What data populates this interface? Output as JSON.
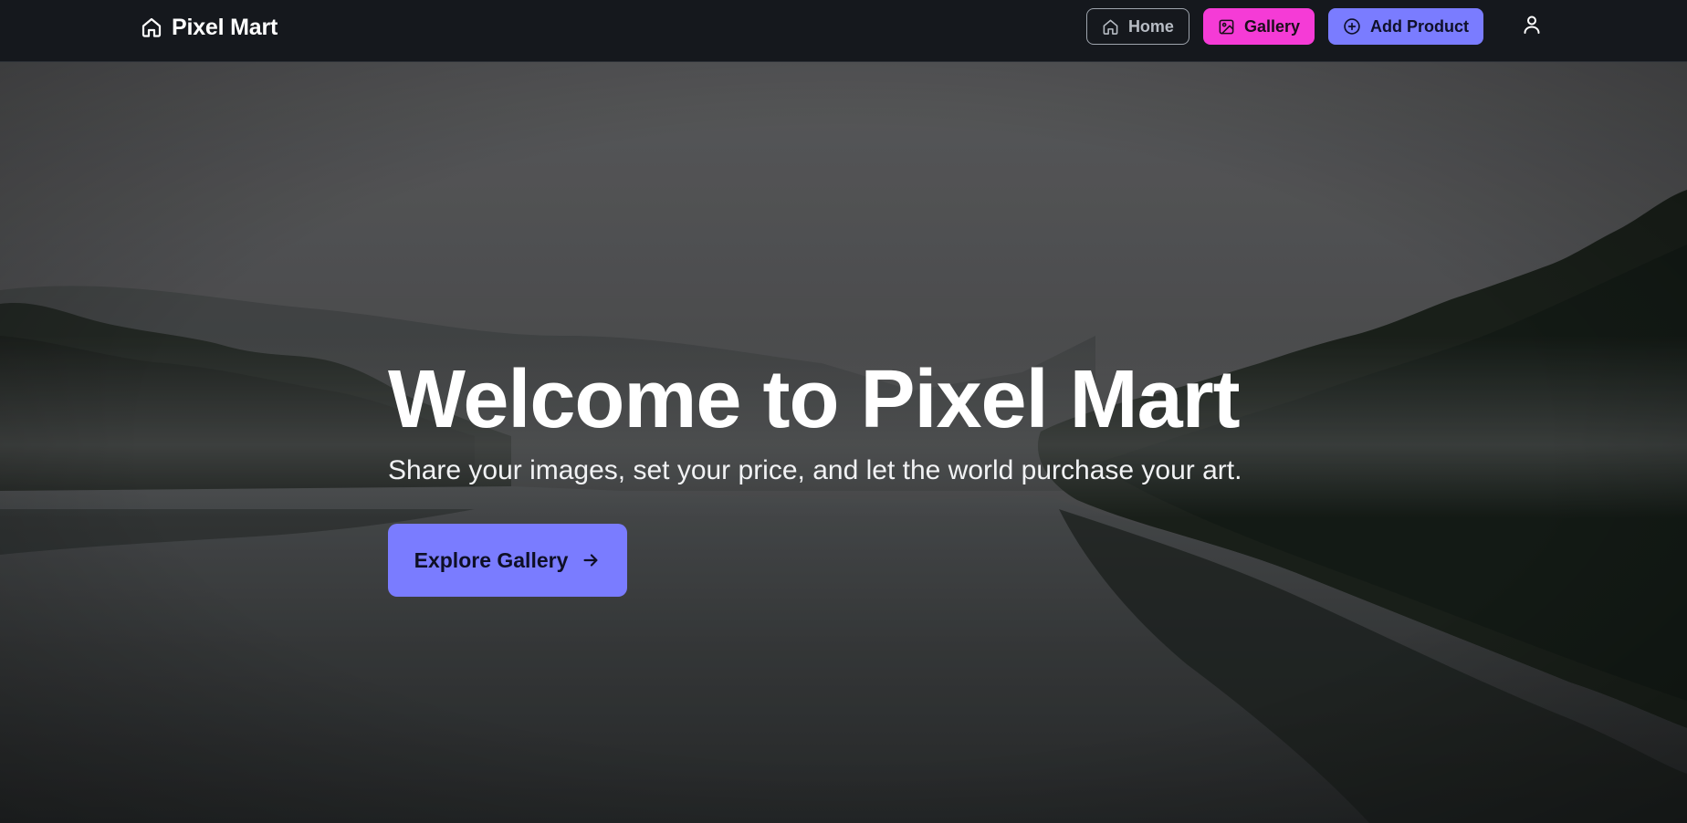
{
  "brand": {
    "name": "Pixel Mart",
    "icon": "home-icon"
  },
  "nav": {
    "home_label": "Home",
    "gallery_label": "Gallery",
    "add_product_label": "Add Product",
    "icons": {
      "home": "home-icon",
      "gallery": "image-icon",
      "add_product": "plus-circle-icon",
      "account": "user-icon"
    }
  },
  "hero": {
    "title": "Welcome to Pixel Mart",
    "subtitle": "Share your images, set your price, and let the world purchase your art.",
    "cta_label": "Explore Gallery",
    "cta_icon": "arrow-right-icon"
  },
  "colors": {
    "navbar_bg": "#15181d",
    "gallery_accent": "#f53bd6",
    "primary_accent": "#7a7cff",
    "text_light": "#ffffff"
  }
}
